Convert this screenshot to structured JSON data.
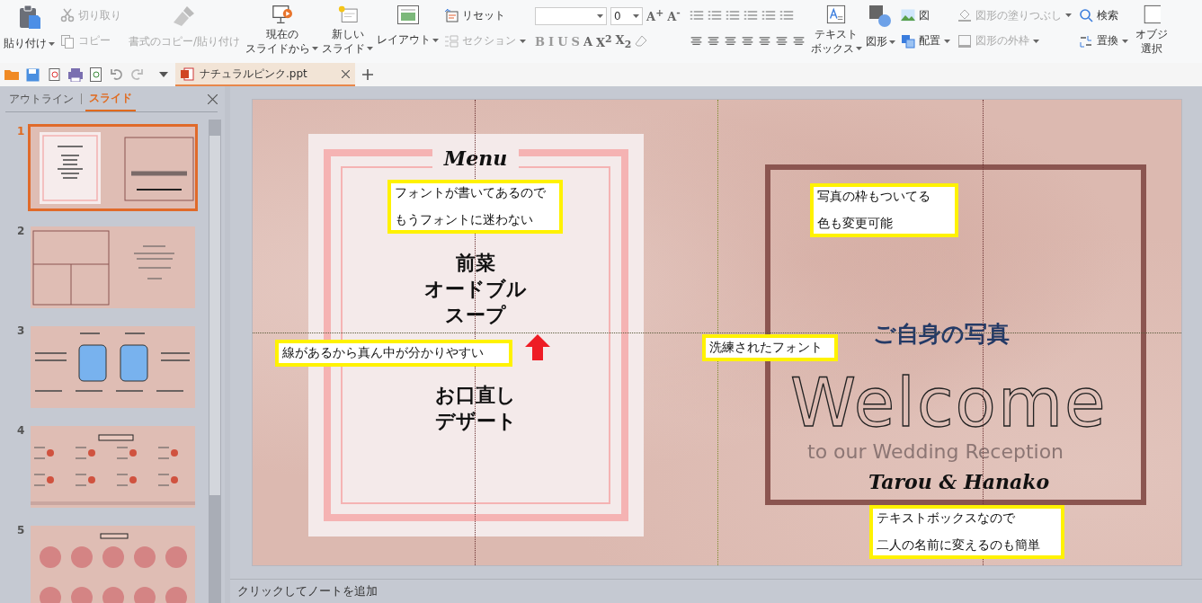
{
  "ribbon": {
    "paste": {
      "label": "貼り付け"
    },
    "cut": {
      "label": "切り取り",
      "disabled": true
    },
    "copy": {
      "label": "コピー",
      "disabled": true
    },
    "format_painter": {
      "label": "書式のコピー/貼り付け",
      "disabled": true
    },
    "from_current": {
      "lines": [
        "現在の",
        "スライドから"
      ]
    },
    "new_slide": {
      "lines": [
        "新しい",
        "スライド"
      ]
    },
    "layout": {
      "label": "レイアウト"
    },
    "reset": {
      "label": "リセット"
    },
    "section": {
      "label": "セクション",
      "disabled": true
    },
    "font_size": {
      "value": "0"
    },
    "size_buttons": [
      {
        "label": "A$^{+}$"
      },
      {
        "label": "A$^{-}$"
      }
    ],
    "format_buttons": [
      {
        "label": "B",
        "disabled": true
      },
      {
        "label": "I",
        "disabled": true
      },
      {
        "label": "U",
        "disabled": true
      },
      {
        "label": "S",
        "disabled": true
      },
      {
        "label": "A",
        "disabled": false
      },
      {
        "label": "X$^{2}$",
        "disabled": false
      },
      {
        "label": "X$_{2}$",
        "disabled": false
      }
    ],
    "text_box": {
      "lines": [
        "テキスト",
        "ボックス"
      ]
    },
    "shapes": {
      "label": "図形"
    },
    "picture": {
      "label": "図"
    },
    "arrange": {
      "label": "配置"
    },
    "shape_fill": {
      "label": "図形の塗りつぶし",
      "disabled": true
    },
    "shape_outline": {
      "label": "図形の外枠",
      "disabled": true
    },
    "find": {
      "label": "検索"
    },
    "replace": {
      "label": "置換"
    },
    "select_objects": {
      "lines": [
        "オブジ",
        "選択"
      ]
    }
  },
  "document_tab": {
    "title": "ナチュラルピンク.ppt",
    "selected": true
  },
  "panel": {
    "tabs": [
      {
        "label": "アウトライン",
        "selected": false
      },
      {
        "label": "スライド",
        "selected": true
      }
    ],
    "thumbnails": [
      {
        "number": "1",
        "kind": "menu-welcome",
        "selected": true
      },
      {
        "number": "2",
        "kind": "photo-grid",
        "selected": false
      },
      {
        "number": "3",
        "kind": "profile",
        "selected": false
      },
      {
        "number": "4",
        "kind": "seating",
        "selected": false
      },
      {
        "number": "5",
        "kind": "seating-round",
        "selected": false
      }
    ]
  },
  "slide": {
    "menu": {
      "title": "Menu",
      "items_top": [
        "前菜",
        "オードブル",
        "スープ"
      ],
      "items_bottom": [
        "お口直し",
        "デザート"
      ]
    },
    "photo_caption": "ご自身の写真",
    "welcome": "Welcome",
    "subtitle": "to our Wedding Reception",
    "names": "Tarou & Hanako",
    "callouts": [
      {
        "lines": [
          "フォントが書いてあるので",
          "もうフォントに迷わない"
        ]
      },
      {
        "lines": [
          "線があるから真ん中が分かりやすい"
        ]
      },
      {
        "lines": [
          "写真の枠もついてる",
          "色も変更可能"
        ]
      },
      {
        "lines": [
          "洗練されたフォント"
        ]
      },
      {
        "lines": [
          "テキストボックスなので",
          "二人の名前に変えるのも簡単"
        ]
      }
    ]
  },
  "notes": {
    "placeholder": "クリックしてノートを追加"
  }
}
